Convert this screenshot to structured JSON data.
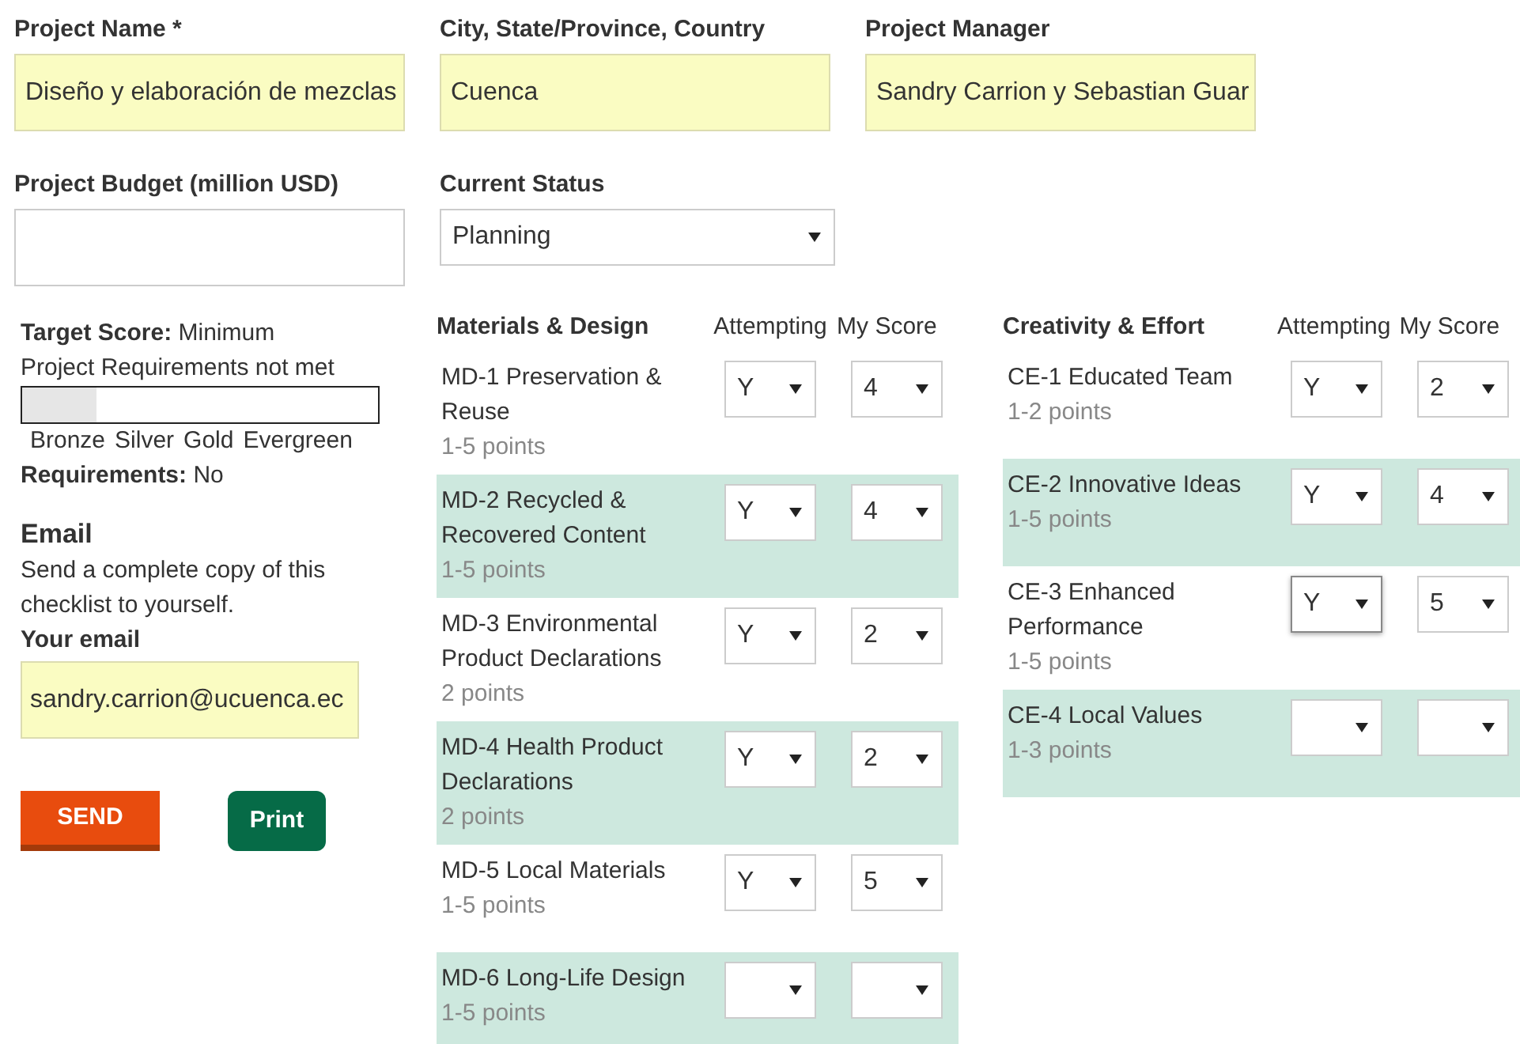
{
  "project_fields": [
    {
      "label": "Project Name *",
      "value": "Diseño y elaboración de mezclas",
      "highlighted": true
    },
    {
      "label": "City, State/Province, Country",
      "value": "Cuenca",
      "highlighted": true
    },
    {
      "label": "Project Manager",
      "value": "Sandry Carrion y Sebastian Guar",
      "highlighted": true
    }
  ],
  "budget": {
    "label": "Project Budget (million USD)",
    "highlighted": false
  },
  "status": {
    "label": "Current Status",
    "value": "Planning"
  },
  "target": {
    "label": "Target Score:",
    "value": "Minimum",
    "note": "Project Requirements not met",
    "level": 0.21,
    "tiers": [
      "Bronze",
      "Silver",
      "Gold",
      "Evergreen"
    ],
    "requirements_label": "Requirements:",
    "requirements_value": "No"
  },
  "email": {
    "heading": "Email",
    "description": "Send a complete copy of this checklist to yourself.",
    "label": "Your email",
    "value": "sandry.carrion@ucuenca.ec"
  },
  "buttons": [
    {
      "label": "SEND",
      "kind": "send"
    },
    {
      "label": "Print",
      "kind": "print"
    }
  ],
  "categories": [
    {
      "title": "Materials & Design",
      "columns": [
        "Attempting",
        "My Score"
      ],
      "credits": [
        {
          "name": "MD-1 Preservation & Reuse",
          "points": "1-5 points",
          "highlighted": false,
          "attempting": {
            "value": "Y",
            "focused": false
          },
          "score": {
            "value": "4",
            "focused": false
          }
        },
        {
          "name": "MD-2 Recycled & Recovered Content",
          "points": "1-5 points",
          "highlighted": true,
          "attempting": {
            "value": "Y",
            "focused": false
          },
          "score": {
            "value": "4",
            "focused": false
          }
        },
        {
          "name": "MD-3 Environmental Product Declarations",
          "points": "2 points",
          "highlighted": false,
          "attempting": {
            "value": "Y",
            "focused": false
          },
          "score": {
            "value": "2",
            "focused": false
          }
        },
        {
          "name": "MD-4 Health Product Declarations",
          "points": "2 points",
          "highlighted": true,
          "attempting": {
            "value": "Y",
            "focused": false
          },
          "score": {
            "value": "2",
            "focused": false
          }
        },
        {
          "name": "MD-5 Local Materials",
          "points": "1-5 points",
          "highlighted": false,
          "attempting": {
            "value": "Y",
            "focused": false
          },
          "score": {
            "value": "5",
            "focused": false
          }
        },
        {
          "name": "MD-6 Long-Life Design",
          "points": "1-5 points",
          "highlighted": true,
          "attempting": {
            "focused": false
          },
          "score": {
            "focused": false
          }
        }
      ]
    },
    {
      "title": "Creativity & Effort",
      "columns": [
        "Attempting",
        "My Score"
      ],
      "credits": [
        {
          "name": "CE-1 Educated Team",
          "points": "1-2 points",
          "highlighted": false,
          "attempting": {
            "value": "Y",
            "focused": false
          },
          "score": {
            "value": "2",
            "focused": false
          }
        },
        {
          "name": "CE-2 Innovative Ideas",
          "points": "1-5 points",
          "highlighted": true,
          "attempting": {
            "value": "Y",
            "focused": false
          },
          "score": {
            "value": "4",
            "focused": false
          }
        },
        {
          "name": "CE-3 Enhanced Performance",
          "points": "1-5 points",
          "highlighted": false,
          "attempting": {
            "value": "Y",
            "focused": true
          },
          "score": {
            "value": "5",
            "focused": false
          }
        },
        {
          "name": "CE-4 Local Values",
          "points": "1-3 points",
          "highlighted": true,
          "attempting": {
            "focused": false
          },
          "score": {
            "focused": false
          }
        }
      ]
    }
  ]
}
